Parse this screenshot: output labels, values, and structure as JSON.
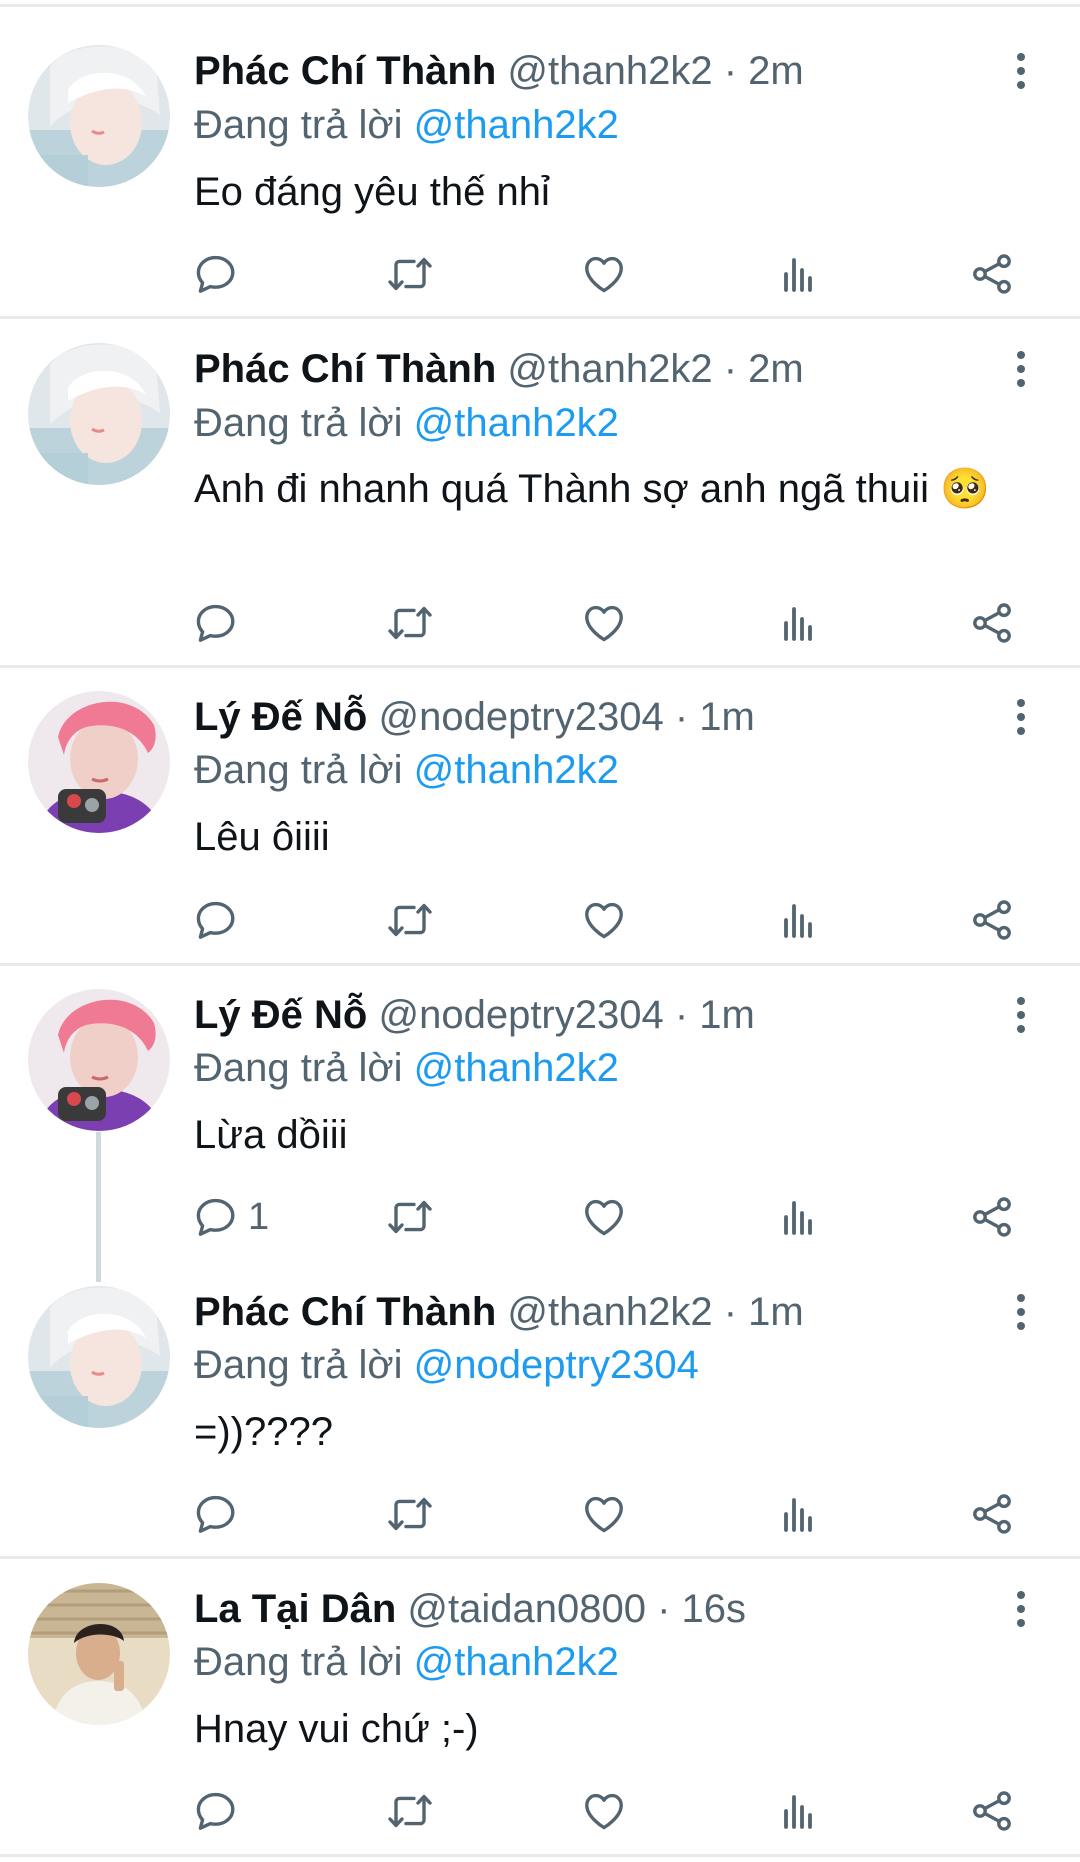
{
  "icons": {
    "reply": "reply-icon",
    "retweet": "retweet-icon",
    "like": "like-icon",
    "views": "views-icon",
    "share": "share-icon",
    "more": "more-vertical-icon"
  },
  "colors": {
    "text": "#0f1419",
    "muted": "#536471",
    "mention": "#1d9bf0",
    "divider": "#e6eaed",
    "thread_line": "#cfd9de"
  },
  "tweets": [
    {
      "name": "Phác Chí Thành",
      "handle": "@thanh2k2",
      "time": "· 2m",
      "reply_prefix": "Đang trả lời",
      "reply_to": "@thanh2k2",
      "text": "Eo đáng yêu thế nhỉ",
      "reply_count": ""
    },
    {
      "name": "Phác Chí Thành",
      "handle": "@thanh2k2",
      "time": "· 2m",
      "reply_prefix": "Đang trả lời",
      "reply_to": "@thanh2k2",
      "text": "Anh đi nhanh quá Thành sợ anh ngã thuii 🥺",
      "reply_count": ""
    },
    {
      "name": "Lý Đế Nỗ",
      "handle": "@nodeptry2304",
      "time": "· 1m",
      "reply_prefix": "Đang trả lời",
      "reply_to": "@thanh2k2",
      "text": "Lêu ôiiii",
      "reply_count": ""
    },
    {
      "name": "Lý Đế Nỗ",
      "handle": "@nodeptry2304",
      "time": "· 1m",
      "reply_prefix": "Đang trả lời",
      "reply_to": "@thanh2k2",
      "text": "Lừa dồiii",
      "reply_count": "1"
    },
    {
      "name": "Phác Chí Thành",
      "handle": "@thanh2k2",
      "time": "· 1m",
      "reply_prefix": "Đang trả lời",
      "reply_to": "@nodeptry2304",
      "text": "=))????",
      "reply_count": ""
    },
    {
      "name": "La Tại Dân",
      "handle": "@taidan0800",
      "time": "· 16s",
      "reply_prefix": "Đang trả lời",
      "reply_to": "@thanh2k2",
      "text": "Hnay vui chứ ;-)",
      "reply_count": ""
    }
  ]
}
